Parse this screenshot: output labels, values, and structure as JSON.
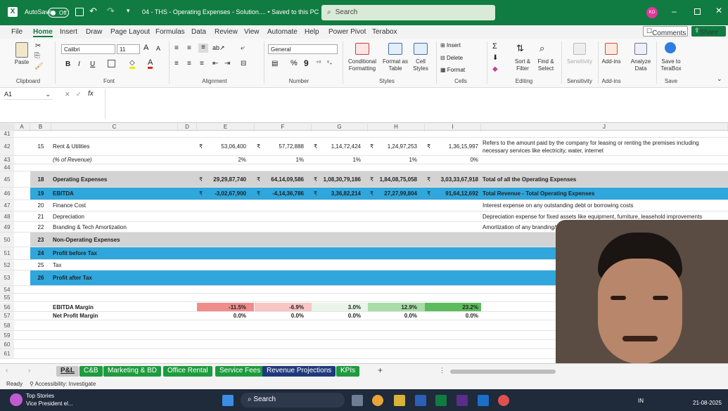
{
  "titlebar": {
    "autosave": "AutoSave",
    "toggle": "Off",
    "filename": "04 - THS - Operating Expenses - Solution.... • Saved to this PC",
    "search": "Search",
    "avatar": "KO"
  },
  "menu": [
    "File",
    "Home",
    "Insert",
    "Draw",
    "Page Layout",
    "Formulas",
    "Data",
    "Review",
    "View",
    "Automate",
    "Help",
    "Power Pivot",
    "Terabox"
  ],
  "menu_right": {
    "comments": "Comments",
    "share": "Share"
  },
  "ribbon": {
    "clipboard": {
      "paste": "Paste",
      "label": "Clipboard"
    },
    "font": {
      "name": "Calibri",
      "size": "11",
      "bold": "B",
      "italic": "I",
      "underline": "U",
      "grow": "A",
      "shrink": "A",
      "label": "Font"
    },
    "alignment": {
      "label": "Alignment"
    },
    "number": {
      "format": "General",
      "percent": "%",
      "comma": "9",
      "label": "Number"
    },
    "styles": {
      "cond": "Conditional",
      "cond2": "Formatting",
      "fmt": "Format as",
      "fmt2": "Table",
      "cell": "Cell",
      "cell2": "Styles",
      "label": "Styles"
    },
    "cells": {
      "insert": "Insert",
      "delete": "Delete",
      "format": "Format",
      "label": "Cells"
    },
    "editing": {
      "sum": "Σ",
      "sort": "Sort &",
      "sort2": "Filter",
      "find": "Find &",
      "find2": "Select",
      "label": "Editing"
    },
    "sensitivity": {
      "btn": "Sensitivity",
      "label": "Sensitivity"
    },
    "addins": {
      "btn": "Add-ins",
      "label": "Add-ins"
    },
    "analyze": {
      "btn": "Analyze",
      "btn2": "Data"
    },
    "save": {
      "btn": "Save to",
      "btn2": "TeraBox",
      "label": "Save"
    }
  },
  "formula": {
    "namebox": "A1",
    "x": "✕",
    "check": "✓",
    "fx": "fx"
  },
  "columns": [
    "A",
    "B",
    "C",
    "D",
    "E",
    "F",
    "G",
    "H",
    "I",
    "J"
  ],
  "rows": [
    {
      "n": "41",
      "b": "",
      "c": "",
      "e": "",
      "f": "",
      "g": "",
      "h": "",
      "i": "",
      "j": ""
    },
    {
      "n": "42",
      "b": "15",
      "c": "Rent & Utilities",
      "e": "53,06,400",
      "f": "57,72,888",
      "g": "1,14,72,424",
      "h": "1,24,97,253",
      "i": "1,36,15,997",
      "j": "Refers to the amount paid by the company for leasing or renting the premises including necessary services like electricity, water, internet"
    },
    {
      "n": "43",
      "b": "",
      "c": "(% of Revenue)",
      "e": "2%",
      "f": "1%",
      "g": "1%",
      "h": "1%",
      "i": "0%",
      "j": ""
    },
    {
      "n": "44",
      "b": "",
      "c": "",
      "e": "",
      "f": "",
      "g": "",
      "h": "",
      "i": "",
      "j": ""
    },
    {
      "n": "45",
      "b": "18",
      "c": "Operating Expenses",
      "e": "29,29,87,740",
      "f": "64,14,09,586",
      "g": "1,08,30,79,186",
      "h": "1,84,08,75,058",
      "i": "3,03,33,67,918",
      "j": "Total of all the Operating Expenses"
    },
    {
      "n": "46",
      "b": "19",
      "c": "EBITDA",
      "e": "-3,02,67,900",
      "f": "-4,14,36,786",
      "g": "3,36,82,214",
      "h": "27,27,99,804",
      "i": "91,64,12,692",
      "j": "Total Revenue - Total Operating Expenses"
    },
    {
      "n": "47",
      "b": "20",
      "c": "Finance Cost",
      "e": "",
      "f": "",
      "g": "",
      "h": "",
      "i": "",
      "j": "Interest expense on any outstanding debt or borrowing costs"
    },
    {
      "n": "48",
      "b": "21",
      "c": "Depreciation",
      "e": "",
      "f": "",
      "g": "",
      "h": "",
      "i": "",
      "j": "Depreciation expense for fixed assets like equipment, furniture, leasehold improvements"
    },
    {
      "n": "49",
      "b": "22",
      "c": "Branding & Tech Amortization",
      "e": "",
      "f": "",
      "g": "",
      "h": "",
      "i": "",
      "j": "Amortization of any branding/t"
    },
    {
      "n": "50",
      "b": "23",
      "c": "Non-Operating Expenses",
      "e": "",
      "f": "",
      "g": "",
      "h": "",
      "i": "",
      "j": ""
    },
    {
      "n": "51",
      "b": "24",
      "c": "Profit before Tax",
      "e": "",
      "f": "",
      "g": "",
      "h": "",
      "i": "",
      "j": ""
    },
    {
      "n": "52",
      "b": "25",
      "c": "Tax",
      "e": "",
      "f": "",
      "g": "",
      "h": "",
      "i": "",
      "j": ""
    },
    {
      "n": "53",
      "b": "26",
      "c": "Profit after Tax",
      "e": "",
      "f": "",
      "g": "",
      "h": "",
      "i": "",
      "j": ""
    },
    {
      "n": "54",
      "b": "",
      "c": "",
      "e": "",
      "f": "",
      "g": "",
      "h": "",
      "i": "",
      "j": ""
    },
    {
      "n": "55",
      "b": "",
      "c": "",
      "e": "",
      "f": "",
      "g": "",
      "h": "",
      "i": "",
      "j": ""
    },
    {
      "n": "56",
      "b": "",
      "c": "EBITDA Margin",
      "e": "-11.5%",
      "f": "-6.9%",
      "g": "3.0%",
      "h": "12.9%",
      "i": "23.2%",
      "j": ""
    },
    {
      "n": "57",
      "b": "",
      "c": "Net Profit Margin",
      "e": "0.0%",
      "f": "0.0%",
      "g": "0.0%",
      "h": "0.0%",
      "i": "0.0%",
      "j": ""
    },
    {
      "n": "58",
      "b": "",
      "c": "",
      "e": "",
      "f": "",
      "g": "",
      "h": "",
      "i": "",
      "j": ""
    },
    {
      "n": "59",
      "b": "",
      "c": "",
      "e": "",
      "f": "",
      "g": "",
      "h": "",
      "i": "",
      "j": ""
    },
    {
      "n": "60",
      "b": "",
      "c": "",
      "e": "",
      "f": "",
      "g": "",
      "h": "",
      "i": "",
      "j": ""
    },
    {
      "n": "61",
      "b": "",
      "c": "",
      "e": "",
      "f": "",
      "g": "",
      "h": "",
      "i": "",
      "j": ""
    }
  ],
  "rupee": "₹",
  "sheets": [
    {
      "name": "P&L",
      "color": "#c8c8c8",
      "fg": "#222"
    },
    {
      "name": "C&B",
      "color": "#1e9b3e",
      "fg": "#fff"
    },
    {
      "name": "Marketing & BD",
      "color": "#1e9b3e",
      "fg": "#fff"
    },
    {
      "name": "Office Rental",
      "color": "#1e9b3e",
      "fg": "#fff"
    },
    {
      "name": "Service Fees",
      "color": "#1e9b3e",
      "fg": "#fff"
    },
    {
      "name": "Revenue Projections",
      "color": "#1f3a7a",
      "fg": "#fff"
    },
    {
      "name": "KPIs",
      "color": "#1e9b3e",
      "fg": "#fff"
    }
  ],
  "status": {
    "ready": "Ready",
    "accessibility": "Accessibility: Investigate"
  },
  "taskbar": {
    "news_title": "Top Stories",
    "news_sub": "Vice President el...",
    "search": "Search",
    "lang": "IN",
    "date": "21-08-2025"
  },
  "colors": {
    "excel_green": "#107c41",
    "header_blue": "#2fa6dc",
    "gray_band": "#d3d3d3"
  }
}
